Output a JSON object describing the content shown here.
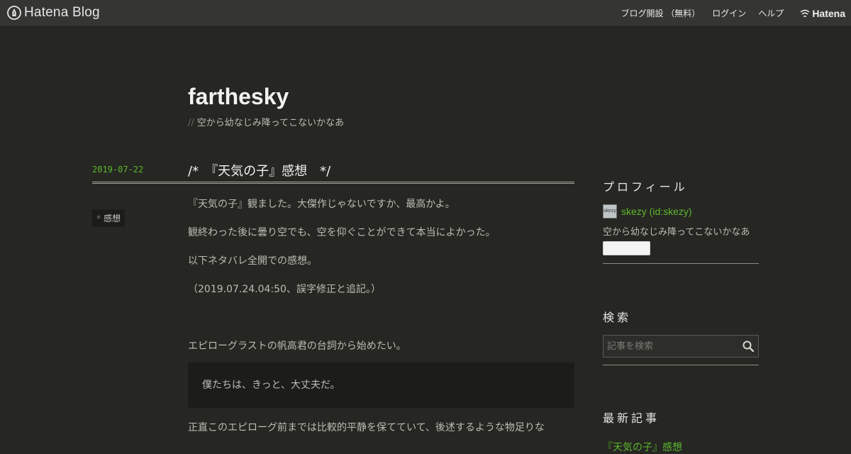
{
  "header": {
    "logo_text": "Hatena Blog",
    "nav": {
      "signup": "ブログ開設 （無料）",
      "login": "ログイン",
      "help": "ヘルプ"
    },
    "brand_text": "Hatena"
  },
  "blog": {
    "title": "farthesky",
    "description_prefix": "//",
    "description": "空から幼なじみ降ってこないかなあ"
  },
  "entry": {
    "date": "2019-07-22",
    "title": "/*　『天気の子』感想　*/",
    "category_marker": "*",
    "category": "感想",
    "paragraphs": {
      "p1": "『天気の子』観ました。大傑作じゃないですか、最高かよ。",
      "p2": "観終わった後に曇り空でも、空を仰ぐことができて本当によかった。",
      "p3": "以下ネタバレ全開での感想。",
      "p4": "（2019.07.24.04:50、誤字修正と追記。）",
      "p5": "エピローグラストの帆高君の台詞から始めたい。",
      "quote": "僕たちは、きっと、大丈夫だ。",
      "p6": "正直このエピローグ前までは比較的平静を保てていて、後述するような物足りな"
    }
  },
  "sidebar": {
    "profile": {
      "title": "プロフィール",
      "avatar_label": "skezy",
      "link": "skezy (id:skezy)",
      "description": "空から幼なじみ降ってこないかなあ"
    },
    "search": {
      "title": "検索",
      "placeholder": "記事を検索"
    },
    "recent": {
      "title": "最新記事",
      "first": "『天気の子』感想"
    }
  },
  "colors": {
    "background": "#262622",
    "header": "#353533",
    "accent_green": "#5cb82f",
    "text": "#bdbdb5",
    "quote_bg": "#1c1c1a"
  },
  "icons": {
    "logo": "hatena-blog-pen-icon",
    "brand": "hatena-wifi-icon",
    "search": "search-icon"
  }
}
